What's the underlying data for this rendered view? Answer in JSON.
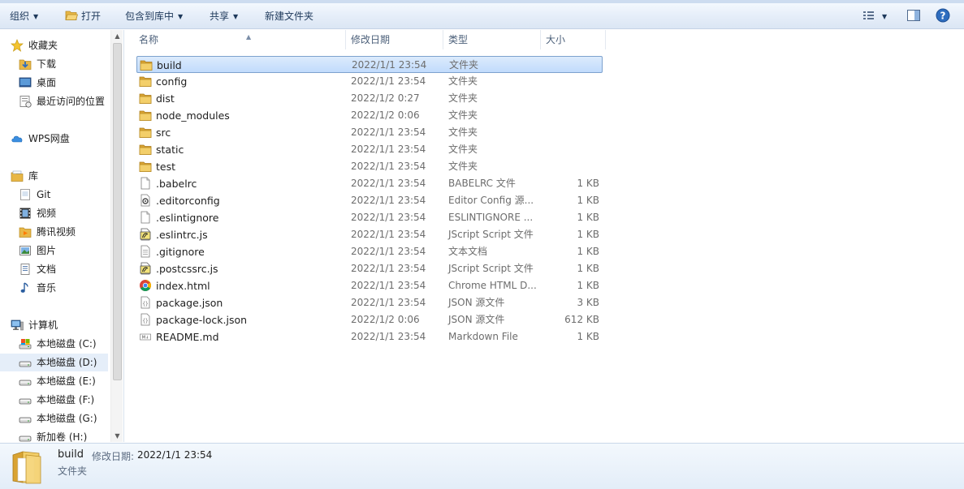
{
  "toolbar": {
    "organize": "组织",
    "open": "打开",
    "include_in_library": "包含到库中",
    "share": "共享",
    "new_folder": "新建文件夹"
  },
  "nav": {
    "favorites": "收藏夹",
    "downloads": "下载",
    "desktop": "桌面",
    "recent": "最近访问的位置",
    "wps": "WPS网盘",
    "libraries": "库",
    "git": "Git",
    "videos": "视频",
    "tencent_video": "腾讯视频",
    "pictures": "图片",
    "documents": "文档",
    "music": "音乐",
    "computer": "计算机",
    "drive_c": "本地磁盘 (C:)",
    "drive_d": "本地磁盘 (D:)",
    "drive_e": "本地磁盘 (E:)",
    "drive_f": "本地磁盘 (F:)",
    "drive_g": "本地磁盘 (G:)",
    "drive_h": "新加卷 (H:)"
  },
  "columns": {
    "name": "名称",
    "date": "修改日期",
    "type": "类型",
    "size": "大小"
  },
  "files": [
    {
      "name": "build",
      "date": "2022/1/1 23:54",
      "type": "文件夹",
      "size": "",
      "icon": "folder-icon"
    },
    {
      "name": "config",
      "date": "2022/1/1 23:54",
      "type": "文件夹",
      "size": "",
      "icon": "folder-icon"
    },
    {
      "name": "dist",
      "date": "2022/1/2 0:27",
      "type": "文件夹",
      "size": "",
      "icon": "folder-icon"
    },
    {
      "name": "node_modules",
      "date": "2022/1/2 0:06",
      "type": "文件夹",
      "size": "",
      "icon": "folder-icon"
    },
    {
      "name": "src",
      "date": "2022/1/1 23:54",
      "type": "文件夹",
      "size": "",
      "icon": "folder-icon"
    },
    {
      "name": "static",
      "date": "2022/1/1 23:54",
      "type": "文件夹",
      "size": "",
      "icon": "folder-icon"
    },
    {
      "name": "test",
      "date": "2022/1/1 23:54",
      "type": "文件夹",
      "size": "",
      "icon": "folder-icon"
    },
    {
      "name": ".babelrc",
      "date": "2022/1/1 23:54",
      "type": "BABELRC 文件",
      "size": "1 KB",
      "icon": "blank-file-icon"
    },
    {
      "name": ".editorconfig",
      "date": "2022/1/1 23:54",
      "type": "Editor Config 源...",
      "size": "1 KB",
      "icon": "config-file-icon"
    },
    {
      "name": ".eslintignore",
      "date": "2022/1/1 23:54",
      "type": "ESLINTIGNORE ...",
      "size": "1 KB",
      "icon": "blank-file-icon"
    },
    {
      "name": ".eslintrc.js",
      "date": "2022/1/1 23:54",
      "type": "JScript Script 文件",
      "size": "1 KB",
      "icon": "script-file-icon"
    },
    {
      "name": ".gitignore",
      "date": "2022/1/1 23:54",
      "type": "文本文档",
      "size": "1 KB",
      "icon": "text-file-icon"
    },
    {
      "name": ".postcssrc.js",
      "date": "2022/1/1 23:54",
      "type": "JScript Script 文件",
      "size": "1 KB",
      "icon": "script-file-icon"
    },
    {
      "name": "index.html",
      "date": "2022/1/1 23:54",
      "type": "Chrome HTML D...",
      "size": "1 KB",
      "icon": "chrome-icon"
    },
    {
      "name": "package.json",
      "date": "2022/1/1 23:54",
      "type": "JSON 源文件",
      "size": "3 KB",
      "icon": "json-file-icon"
    },
    {
      "name": "package-lock.json",
      "date": "2022/1/2 0:06",
      "type": "JSON 源文件",
      "size": "612 KB",
      "icon": "json-file-icon"
    },
    {
      "name": "README.md",
      "date": "2022/1/1 23:54",
      "type": "Markdown File",
      "size": "1 KB",
      "icon": "markdown-file-icon"
    }
  ],
  "selected_index": 0,
  "details": {
    "name": "build",
    "date_label": "修改日期:",
    "date_value": "2022/1/1 23:54",
    "type": "文件夹"
  }
}
